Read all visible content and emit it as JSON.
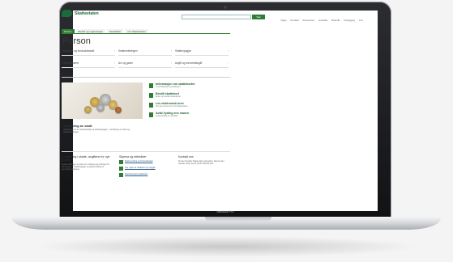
{
  "device": {
    "label": "MacBook Pro"
  },
  "site": {
    "logo_text": "Skatteetaten",
    "top_nav": [
      "Hjelp",
      "Kontakt",
      "Presserom",
      "Ansattlø",
      "Bokmål",
      "Innlogging",
      "A-A"
    ],
    "search_placeholder": "",
    "search_button": "Søk"
  },
  "tabs": [
    "Person",
    "Bedrift og organisasjon",
    "Rettskilder",
    "Om Skatteetaten"
  ],
  "page_title": "Person",
  "menu": [
    "Skattekort og forskuddsskatt",
    "Skattemeldingen",
    "Skatteoppgjør",
    "Folkeregisteret",
    "Arv og gaver",
    "Avgift og merverdiavgift"
  ],
  "hero": {
    "title": "Utbetaling av skatt",
    "text": "Utbetalingene for tilgodebeløp og skatteoppgjør... fordelings av skatt og tilbakebetalinger..."
  },
  "links": [
    {
      "title": "Informasjon om skattekortet",
      "sub": "Forskuddsskatt og skattekort"
    },
    {
      "title": "Bestill skattekort",
      "sub": "Endre og bestille skattekortet"
    },
    {
      "title": "Les elektronisk brev",
      "sub": "Her kan du lese brev fra Skatteetaten"
    },
    {
      "title": "Avtal hyding enn manne",
      "sub": "Avtal betaling av restskatt"
    }
  ],
  "bottom": {
    "col1": {
      "title": "Å vurdering i skatte- avgiftene for nye avgifter",
      "text": "Skattemeldingen og tekst om vurdering og ordninger for utlendinger ... Skatteoppgjør og skattemelding for personlige skattytere."
    },
    "col2": {
      "title": "Skjema og rettskilder",
      "items": [
        "Skattemelding og forskuddsskatt",
        "Nye regler for skattekort og oppgjør",
        "Skatteberegning kalkulator"
      ]
    },
    "col3": {
      "title": "Kontakt oss",
      "text": "Du kan kontakte Skatteetaten på telefon, skjema eller skranke. Ring oss på telefon 800 80 000."
    }
  }
}
